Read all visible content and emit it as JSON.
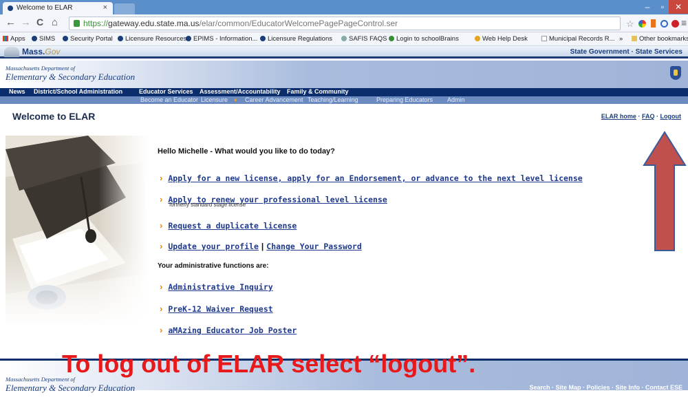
{
  "browser": {
    "tab_title": "Welcome to ELAR",
    "tab_close": "×",
    "window_min": "–",
    "window_max": "▫",
    "window_close": "✕",
    "nav_back": "←",
    "nav_forward": "→",
    "nav_reload": "C",
    "nav_home": "⌂",
    "url_scheme": "https://",
    "url_host": "gateway.edu.state.ma.us",
    "url_path": "/elar/common/EducatorWelcomePagePageControl.ser",
    "star": "☆",
    "menu": "≡",
    "bookmarks": [
      {
        "label": "Apps",
        "icon": "apps-grid-icon"
      },
      {
        "label": "SIMS",
        "icon": "seal-icon"
      },
      {
        "label": "Security Portal",
        "icon": "seal-icon"
      },
      {
        "label": "Licensure Resources",
        "icon": "seal-icon"
      },
      {
        "label": "EPIMS - Information...",
        "icon": "seal-icon"
      },
      {
        "label": "Licensure Regulations",
        "icon": "seal-icon"
      },
      {
        "label": "SAFIS FAQS",
        "icon": "safis-icon"
      },
      {
        "label": "Login to schoolBrains",
        "icon": "schoolbrains-icon"
      },
      {
        "label": "Web Help Desk",
        "icon": "help-desk-icon"
      },
      {
        "label": "Municipal Records R...",
        "icon": "page-icon"
      }
    ],
    "overflow": "»",
    "other_bookmarks": "Other bookmarks"
  },
  "site": {
    "mass_logo_main": "Mass.",
    "mass_logo_suffix": "Gov",
    "state_links": "State Government · State Services",
    "dept_line": "Massachusetts Department of",
    "dept_name": "Elementary & Secondary Education",
    "main_nav": [
      "News",
      "District/School Administration",
      "Educator Services",
      "Assessment/Accountability",
      "Family & Community"
    ],
    "sub_nav": [
      "Become an Educator",
      "Licensure",
      "Career Advancement",
      "Teaching/Learning",
      "Preparing Educators",
      "Admin"
    ]
  },
  "page": {
    "title": "Welcome to ELAR",
    "top_links": {
      "home": "ELAR home",
      "faq": "FAQ",
      "logout": "Logout",
      "sep": "·"
    },
    "greeting": "Hello Michelle - What would you like to do today?",
    "actions": {
      "apply": "Apply for a new license, apply for an Endorsement, or advance to the next level license",
      "renew": "Apply to renew your professional level license",
      "renew_sub": "formerly standard stage license",
      "duplicate": "Request a duplicate license",
      "profile": "Update your profile",
      "sep": "|",
      "password": "Change Your Password"
    },
    "admin_header": "Your administrative functions are:",
    "admin": {
      "inquiry": "Administrative Inquiry",
      "waiver": "PreK-12 Waiver Request",
      "poster": "aMAzing Educator Job Poster"
    },
    "chevron": "›"
  },
  "overlay": {
    "instruction": "To log out of ELAR select “logout”.",
    "arrow_color": "#c0504d",
    "arrow_border": "#3a5a9a"
  },
  "footer": {
    "dept_line": "Massachusetts Department of",
    "dept_name": "Elementary & Secondary Education",
    "links": "Search · Site Map · Policies · Site Info · Contact ESE"
  }
}
